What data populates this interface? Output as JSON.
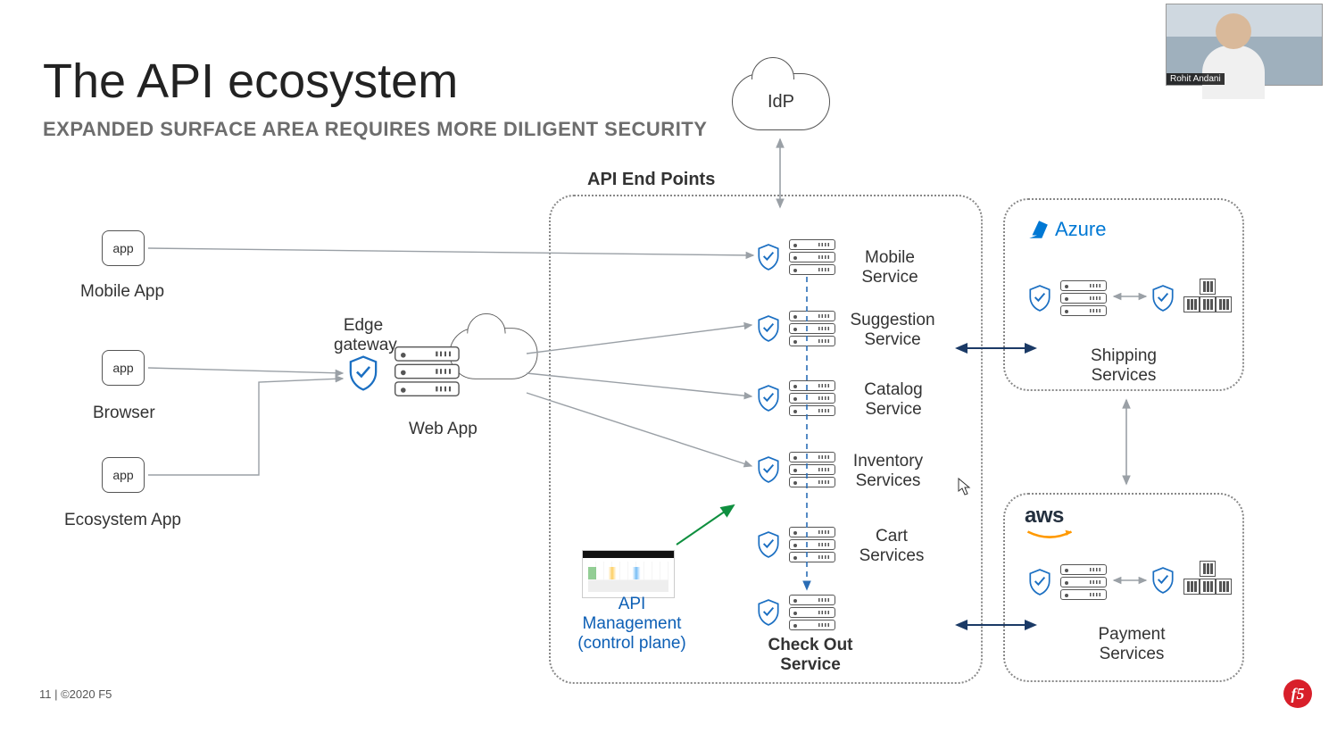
{
  "title": "The API ecosystem",
  "subtitle": "EXPANDED SURFACE AREA REQUIRES MORE DILIGENT SECURITY",
  "footer": "11 | ©2020 F5",
  "logo": "f5",
  "webcam_name": "Rohit Andani",
  "idp": "IdP",
  "api_endpoints_header": "API End Points",
  "clients": {
    "mobile": {
      "box": "app",
      "label": "Mobile App"
    },
    "browser": {
      "box": "app",
      "label": "Browser"
    },
    "ecosystem": {
      "box": "app",
      "label": "Ecosystem App"
    }
  },
  "edge": {
    "label": "Edge gateway",
    "webapp": "Web App"
  },
  "services": [
    {
      "label": "Mobile Service"
    },
    {
      "label": "Suggestion Service"
    },
    {
      "label": "Catalog Service"
    },
    {
      "label": "Inventory Services"
    },
    {
      "label": "Cart Services"
    }
  ],
  "checkout": "Check Out Service",
  "api_mgmt": "API Management (control plane)",
  "clouds": {
    "azure": {
      "name": "Azure",
      "service": "Shipping Services"
    },
    "aws": {
      "name": "aws",
      "service": "Payment Services"
    }
  }
}
